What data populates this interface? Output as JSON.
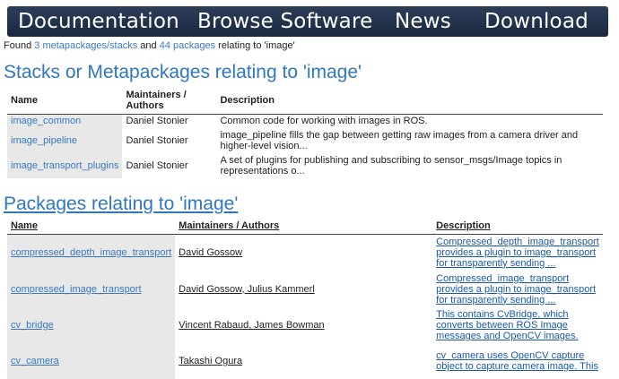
{
  "nav": {
    "items": [
      "Documentation",
      "Browse Software",
      "News",
      "Download"
    ]
  },
  "found": {
    "prefix": "Found",
    "stacks_link": "3 metapackages/stacks",
    "middle": "and",
    "packages_link": "44 packages",
    "suffix": "relating to 'image'"
  },
  "stacks": {
    "heading": "Stacks or Metapackages relating to 'image'",
    "columns": [
      "Name",
      "Maintainers / Authors",
      "Description"
    ],
    "rows": [
      {
        "name": "image_common",
        "maintainers": "Daniel Stonier",
        "description": "Common code for working with images in ROS."
      },
      {
        "name": "image_pipeline",
        "maintainers": "Daniel Stonier",
        "description": "image_pipeline fills the gap between getting raw images from a camera driver and higher-level vision..."
      },
      {
        "name": "image_transport_plugins",
        "maintainers": "Daniel Stonier",
        "description": "A set of plugins for publishing and subscribing to sensor_msgs/Image topics in representations o..."
      }
    ]
  },
  "packages": {
    "heading": "Packages relating to 'image'",
    "columns": [
      "Name",
      "Maintainers / Authors",
      "Description"
    ],
    "rows": [
      {
        "name": "compressed_depth_image_transport",
        "maintainers": "David Gossow",
        "description": "Compressed_depth_image_transport provides a plugin to image_transport for transparently sending ..."
      },
      {
        "name": "compressed_image_transport",
        "maintainers": "David Gossow, Julius Kammerl",
        "description": "Compressed_image_transport provides a plugin to image_transport for transparently sending ..."
      },
      {
        "name": "cv_bridge",
        "maintainers": "Vincent Rabaud, James Bowman",
        "description": "This contains CvBridge, which converts between ROS Image messages and OpenCV images."
      },
      {
        "name": "cv_camera",
        "maintainers": "Takashi Ogura",
        "description": "cv_camera uses OpenCV capture object to capture camera image. This"
      }
    ]
  }
}
